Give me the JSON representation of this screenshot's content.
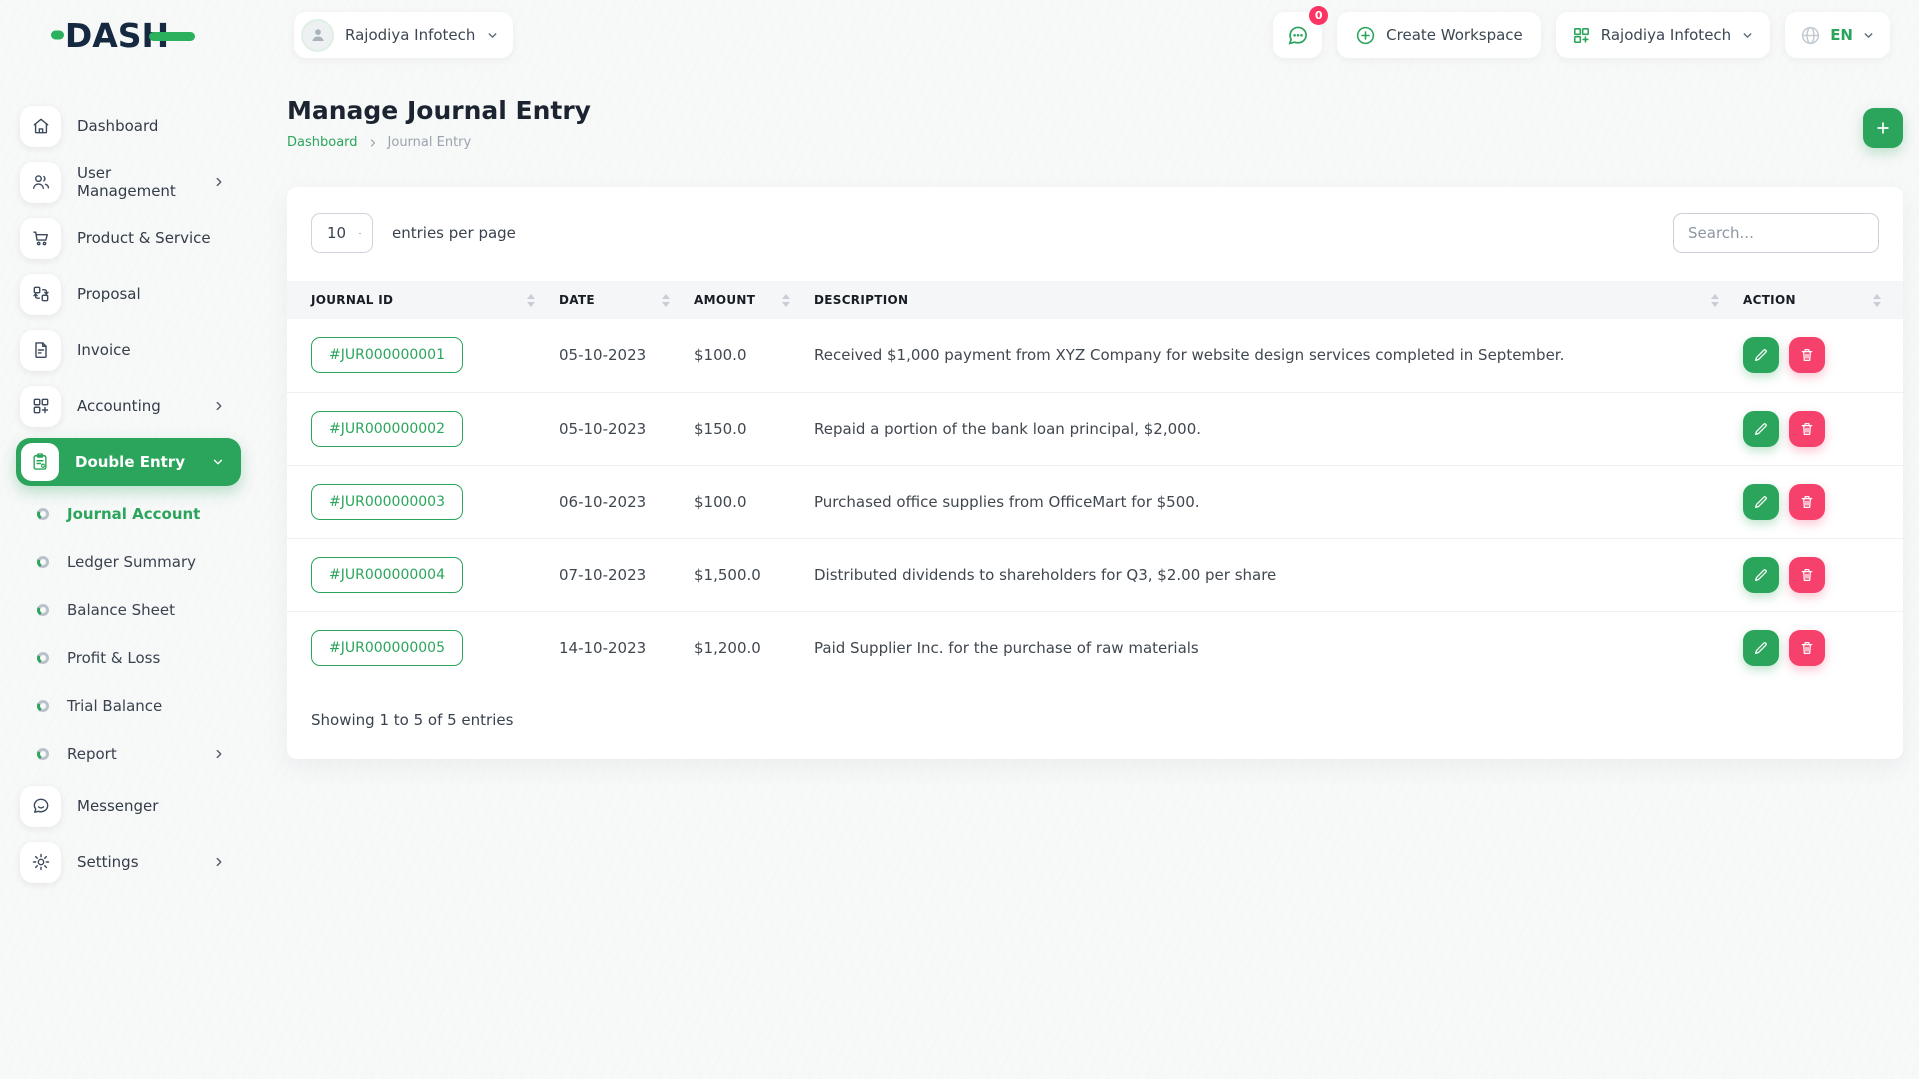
{
  "brand": {
    "logo": "DASH"
  },
  "topbar": {
    "workspace_user": "Rajodiya Infotech",
    "messages_badge": "0",
    "create_workspace_label": "Create Workspace",
    "company_name": "Rajodiya Infotech",
    "language": "EN"
  },
  "sidebar": {
    "items": [
      {
        "label": "Dashboard",
        "icon": "home-icon"
      },
      {
        "label": "User Management",
        "icon": "users-icon",
        "expandable": true
      },
      {
        "label": "Product & Service",
        "icon": "cart-icon"
      },
      {
        "label": "Proposal",
        "icon": "swap-icon"
      },
      {
        "label": "Invoice",
        "icon": "file-icon"
      },
      {
        "label": "Accounting",
        "icon": "grid-plus-icon",
        "expandable": true
      },
      {
        "label": "Double Entry",
        "icon": "clipboard-icon",
        "active": true,
        "expanded": true
      },
      {
        "label": "Messenger",
        "icon": "chat-icon"
      },
      {
        "label": "Settings",
        "icon": "gear-icon",
        "expandable": true
      }
    ],
    "double_entry_submenu": [
      {
        "label": "Journal Account",
        "active": true
      },
      {
        "label": "Ledger Summary"
      },
      {
        "label": "Balance Sheet"
      },
      {
        "label": "Profit & Loss"
      },
      {
        "label": "Trial Balance"
      },
      {
        "label": "Report",
        "expandable": true
      }
    ]
  },
  "page": {
    "title": "Manage Journal Entry",
    "breadcrumb_home": "Dashboard",
    "breadcrumb_current": "Journal Entry"
  },
  "table_controls": {
    "page_size": "10",
    "entries_label": "entries per page",
    "search_placeholder": "Search..."
  },
  "table": {
    "headers": [
      "JOURNAL ID",
      "DATE",
      "AMOUNT",
      "DESCRIPTION",
      "ACTION"
    ],
    "rows": [
      {
        "journal_id": "#JUR000000001",
        "date": "05-10-2023",
        "amount": "$100.0",
        "description": "Received $1,000 payment from XYZ Company for website design services completed in September."
      },
      {
        "journal_id": "#JUR000000002",
        "date": "05-10-2023",
        "amount": "$150.0",
        "description": "Repaid a portion of the bank loan principal, $2,000."
      },
      {
        "journal_id": "#JUR000000003",
        "date": "06-10-2023",
        "amount": "$100.0",
        "description": "Purchased office supplies from OfficeMart for $500."
      },
      {
        "journal_id": "#JUR000000004",
        "date": "07-10-2023",
        "amount": "$1,500.0",
        "description": "Distributed dividends to shareholders for Q3, $2.00 per share"
      },
      {
        "journal_id": "#JUR000000005",
        "date": "14-10-2023",
        "amount": "$1,200.0",
        "description": "Paid Supplier Inc. for the purchase of raw materials"
      }
    ],
    "footer": "Showing 1 to 5 of 5 entries"
  },
  "colors": {
    "accent": "#2ba55c",
    "danger": "#f5416b",
    "badge": "#fd3364",
    "navy": "#152940"
  }
}
